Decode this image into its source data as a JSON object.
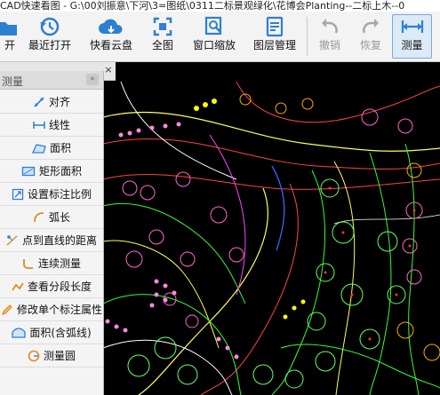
{
  "window": {
    "title": "CAD快速看图 - G:\\00刘振意\\下河\\3=图纸\\0311二标景观绿化\\花博会Planting--二标上木--0"
  },
  "toolbar": {
    "buttons": [
      {
        "id": "open",
        "label": "开",
        "icon": "folder-open-icon",
        "state": "normal"
      },
      {
        "id": "recent",
        "label": "最近打开",
        "icon": "clock-history-icon",
        "state": "normal"
      },
      {
        "id": "cloud",
        "label": "快看云盘",
        "icon": "cloud-icon",
        "state": "normal"
      },
      {
        "id": "fullview",
        "label": "全图",
        "icon": "fit-view-icon",
        "state": "normal"
      },
      {
        "id": "zoomwin",
        "label": "窗口缩放",
        "icon": "zoom-window-icon",
        "state": "normal"
      },
      {
        "id": "layers",
        "label": "图层管理",
        "icon": "layers-icon",
        "state": "normal"
      },
      {
        "id": "undo",
        "label": "撤销",
        "icon": "undo-icon",
        "state": "disabled"
      },
      {
        "id": "redo",
        "label": "恢复",
        "icon": "redo-icon",
        "state": "disabled"
      },
      {
        "id": "measure",
        "label": "测量",
        "icon": "ruler-icon",
        "state": "active"
      }
    ]
  },
  "panel": {
    "title": "测量",
    "close_label": "»",
    "items": [
      {
        "label": "对齐",
        "icon": "align-measure-icon"
      },
      {
        "label": "线性",
        "icon": "linear-measure-icon"
      },
      {
        "label": "面积",
        "icon": "area-icon"
      },
      {
        "label": "矩形面积",
        "icon": "rectangle-area-icon"
      },
      {
        "label": "设置标注比例",
        "icon": "scale-set-icon"
      },
      {
        "label": "弧长",
        "icon": "arc-length-icon"
      },
      {
        "label": "点到直线的距离",
        "icon": "point-line-distance-icon"
      },
      {
        "label": "连续测量",
        "icon": "continuous-measure-icon"
      },
      {
        "label": "查看分段长度",
        "icon": "segment-length-icon"
      },
      {
        "label": "修改单个标注属性",
        "icon": "edit-annotation-icon"
      },
      {
        "label": "面积(含弧线)",
        "icon": "arc-area-icon"
      },
      {
        "label": "测量圆",
        "icon": "circle-measure-icon"
      }
    ]
  },
  "tab": {
    "close_label": "×"
  },
  "colors": {
    "accent": "#2d7fd0",
    "canvas_bg": "#000000",
    "icon_orange": "#e08a1e",
    "icon_blue": "#2d7fd0"
  }
}
